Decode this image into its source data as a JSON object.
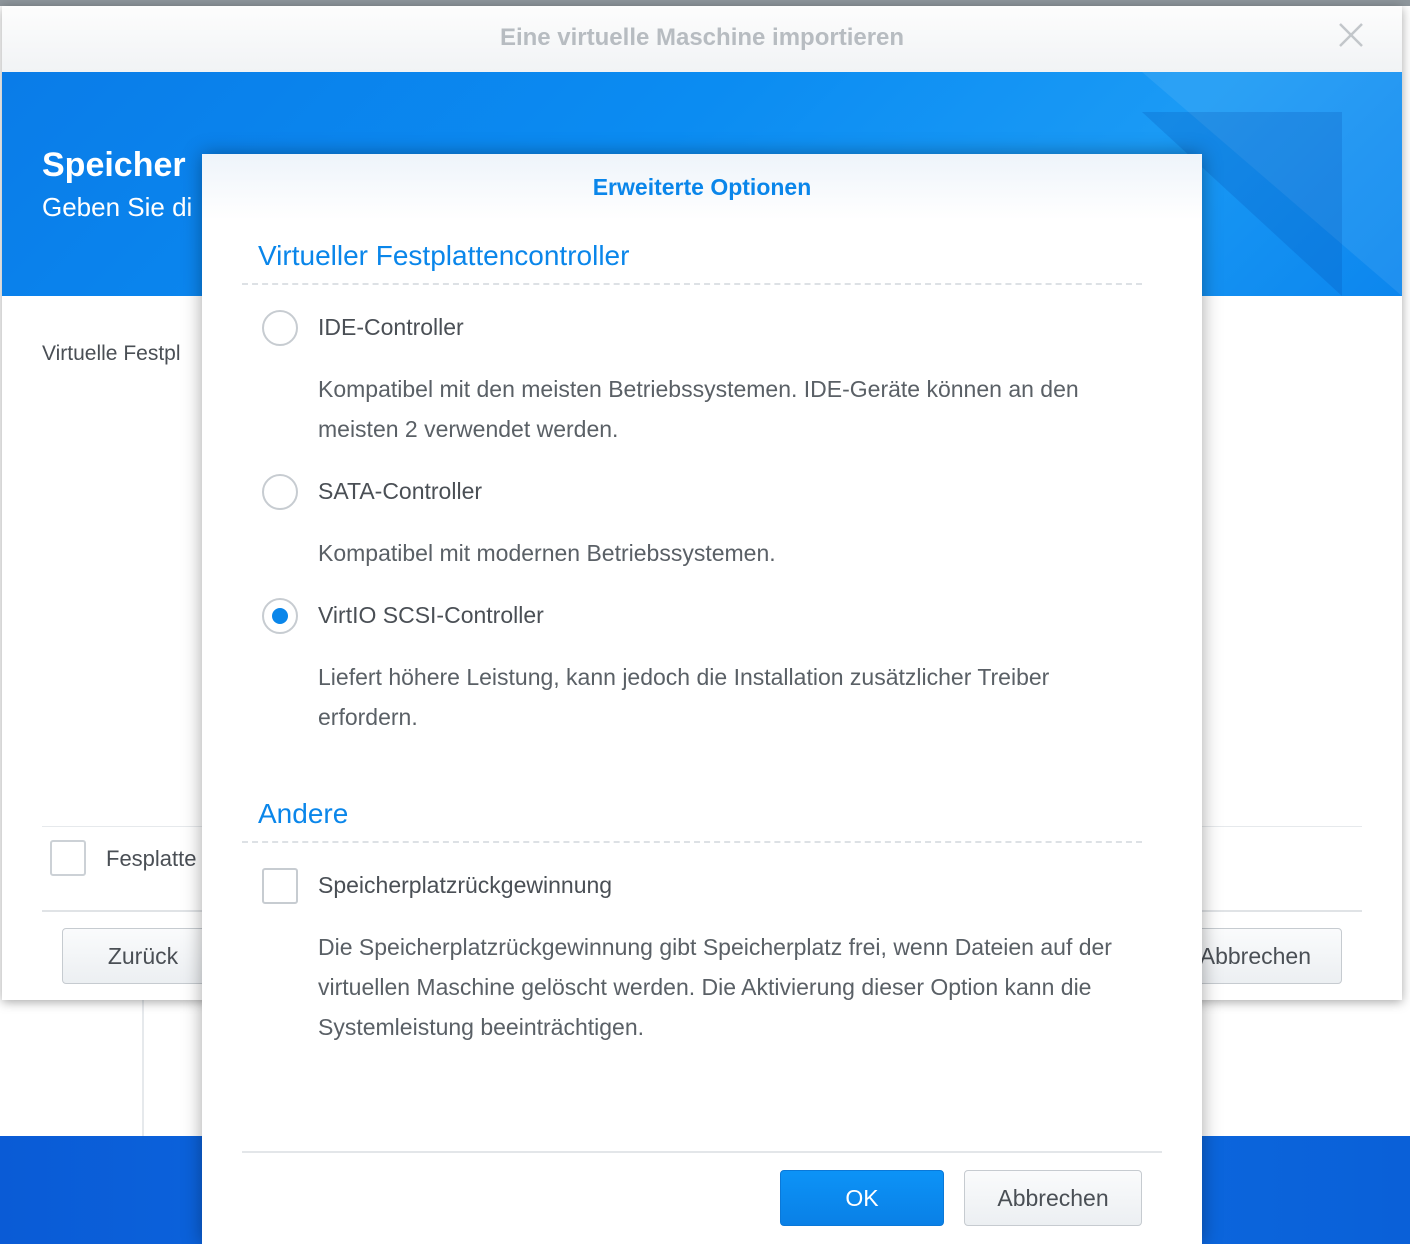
{
  "outer": {
    "window_title": "Eine virtuelle Maschine importieren",
    "heading": "Speicher",
    "subheading": "Geben Sie di",
    "disk_label": "Virtuelle Festpl",
    "checkbox_label": "Fesplatte",
    "back_label": "Zurück",
    "cancel_label": "Abbrechen"
  },
  "modal": {
    "title": "Erweiterte Optionen",
    "controller_section": {
      "title": "Virtueller Festplattencontroller",
      "options": [
        {
          "label": "IDE-Controller",
          "description": "Kompatibel mit den meisten Betriebssystemen. IDE-Geräte können an den meisten 2 verwendet werden.",
          "selected": false
        },
        {
          "label": "SATA-Controller",
          "description": "Kompatibel mit modernen Betriebssystemen.",
          "selected": false
        },
        {
          "label": "VirtIO SCSI-Controller",
          "description": "Liefert höhere Leistung, kann jedoch die Installation zusätzlicher Treiber erfordern.",
          "selected": true
        }
      ]
    },
    "other_section": {
      "title": "Andere",
      "checkbox": {
        "label": "Speicherplatzrückgewinnung",
        "description": "Die Speicherplatzrückgewinnung gibt Speicherplatz frei, wenn Dateien auf der virtuellen Maschine gelöscht werden. Die Aktivierung dieser Option kann die Systemleistung beeinträchtigen.",
        "checked": false
      }
    },
    "ok_label": "OK",
    "cancel_label": "Abbrechen"
  },
  "colors": {
    "accent": "#0a86ea",
    "banner": "#0b8cf2",
    "text": "#4a4f55"
  }
}
